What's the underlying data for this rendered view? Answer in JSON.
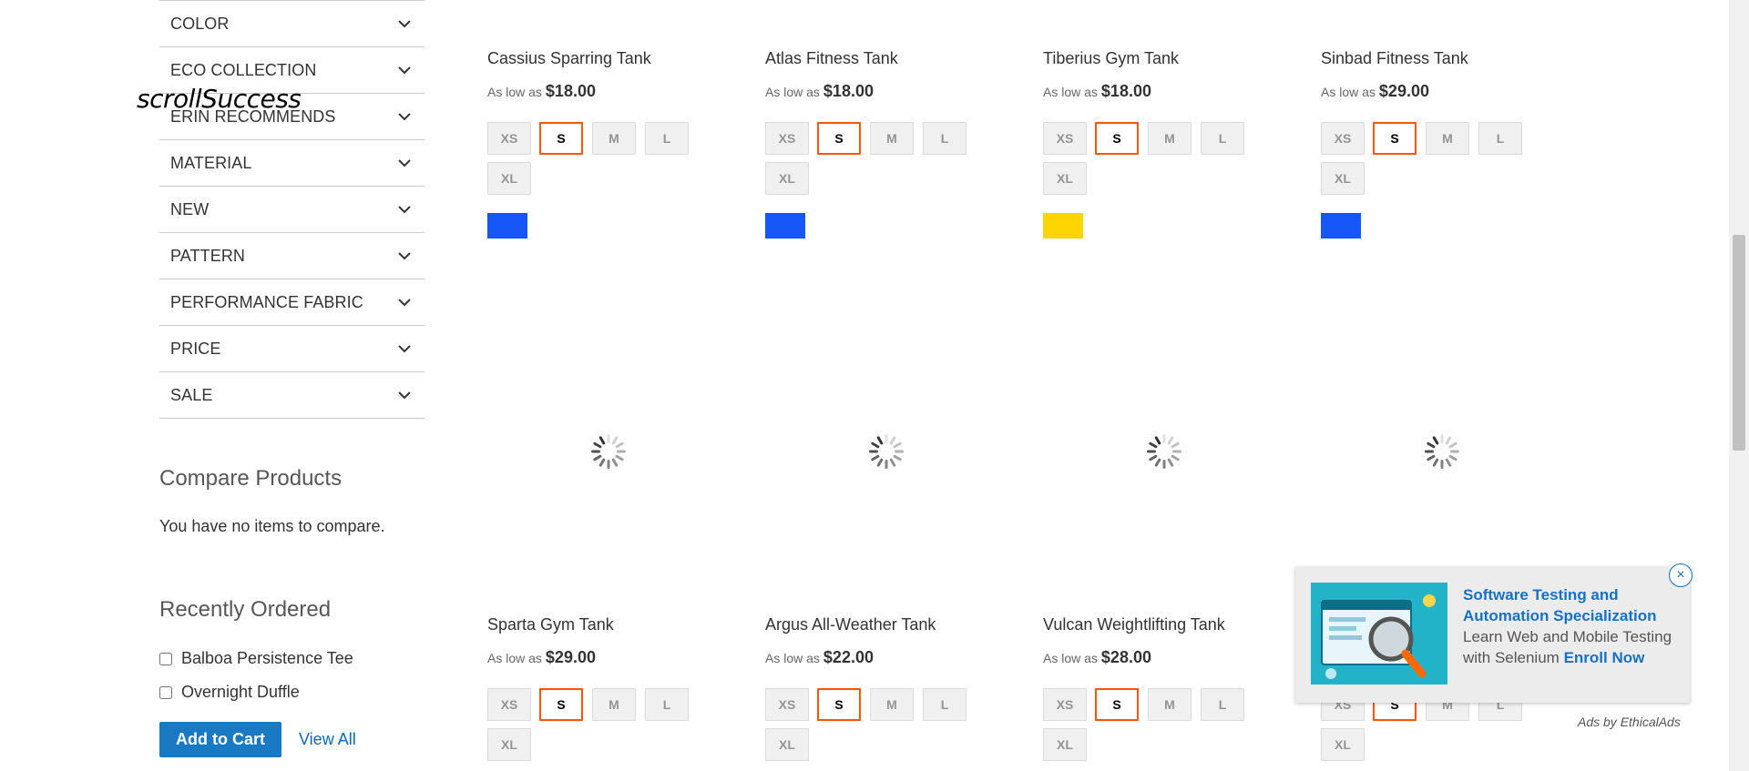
{
  "overlay_text": "scrollSuccess",
  "filters": [
    {
      "label": "COLOR"
    },
    {
      "label": "ECO COLLECTION"
    },
    {
      "label": "ERIN RECOMMENDS"
    },
    {
      "label": "MATERIAL"
    },
    {
      "label": "NEW"
    },
    {
      "label": "PATTERN"
    },
    {
      "label": "PERFORMANCE FABRIC"
    },
    {
      "label": "PRICE"
    },
    {
      "label": "SALE"
    }
  ],
  "compare": {
    "title": "Compare Products",
    "empty_text": "You have no items to compare."
  },
  "recently_ordered": {
    "title": "Recently Ordered",
    "items": [
      {
        "label": "Balboa Persistence Tee",
        "checked": false
      },
      {
        "label": "Overnight Duffle",
        "checked": false
      }
    ],
    "add_to_cart_label": "Add to Cart",
    "view_all_label": "View All"
  },
  "price_prefix": "As low as",
  "sizes": [
    "XS",
    "S",
    "M",
    "L",
    "XL"
  ],
  "selected_size": "S",
  "products_row1": [
    {
      "name": "Cassius Sparring Tank",
      "price": "$18.00",
      "color": "#1857f7"
    },
    {
      "name": "Atlas Fitness Tank",
      "price": "$18.00",
      "color": "#1857f7"
    },
    {
      "name": "Tiberius Gym Tank",
      "price": "$18.00",
      "color": "#ffd500"
    },
    {
      "name": "Sinbad Fitness Tank",
      "price": "$29.00",
      "color": "#1857f7"
    }
  ],
  "products_row2": [
    {
      "name": "Sparta Gym Tank",
      "price": "$29.00"
    },
    {
      "name": "Argus All-Weather Tank",
      "price": "$22.00"
    },
    {
      "name": "Vulcan Weightlifting Tank",
      "price": "$28.00"
    }
  ],
  "ad": {
    "headline": "Software Testing and Automation Specialization",
    "body": "Learn Web and Mobile Testing with Selenium",
    "cta": "Enroll Now",
    "close_label": "×",
    "credit": "Ads by EthicalAds"
  },
  "colors": {
    "accent": "#1979c3",
    "selected_border": "#ff5501",
    "link": "#006bb4",
    "ad_link": "#1771c2"
  }
}
